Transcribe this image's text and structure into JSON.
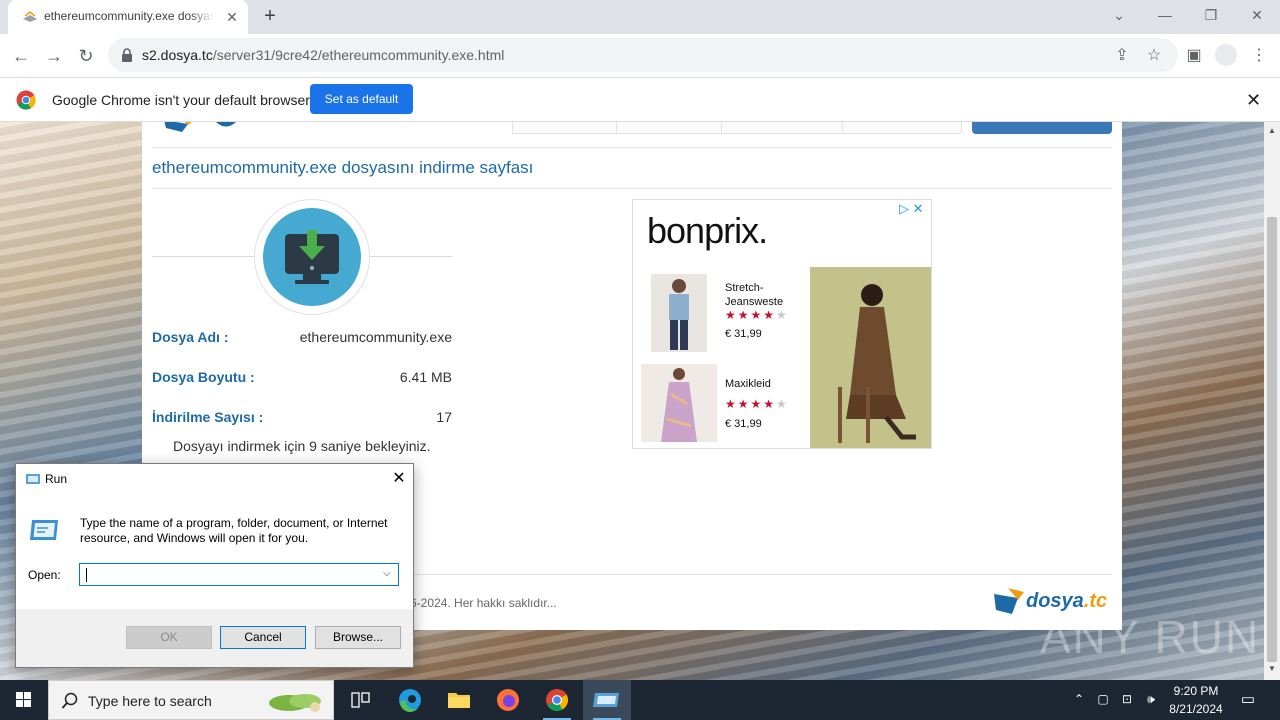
{
  "browser": {
    "tab_title": "ethereumcommunity.exe dosyasını indirme sayfası",
    "url_host": "s2.dosya.tc",
    "url_path": "/server31/9cre42/ethereumcommunity.exe.html",
    "infobar_text": "Google Chrome isn't your default browser",
    "set_default_label": "Set as default"
  },
  "page": {
    "heading": "ethereumcommunity.exe dosyasını indirme sayfası",
    "fields": [
      {
        "label": "Dosya Adı :",
        "value": "ethereumcommunity.exe"
      },
      {
        "label": "Dosya Boyutu :",
        "value": "6.41 MB"
      },
      {
        "label": "İndirilme Sayısı :",
        "value": "17"
      }
    ],
    "wait_text": "Dosyayı indirmek için 9 saniye bekleyiniz.",
    "copyright": "6-2024. Her hakkı saklıdır...",
    "footer_logo": "dosya",
    "footer_logo_tld": ".tc"
  },
  "ad": {
    "brand": "bonprix.",
    "products": [
      {
        "name": "Stretch-Jeansweste",
        "price": "€ 31,99",
        "rating": 4
      },
      {
        "name": "Maxikleid",
        "price": "€ 31,99",
        "rating": 4
      }
    ],
    "star_full": "★★★★",
    "star_empty": "★"
  },
  "run_dialog": {
    "title": "Run",
    "description": "Type the name of a program, folder, document, or Internet resource, and Windows will open it for you.",
    "open_label": "Open:",
    "open_value": "",
    "ok_label": "OK",
    "cancel_label": "Cancel",
    "browse_label": "Browse..."
  },
  "taskbar": {
    "search_placeholder": "Type here to search",
    "time": "9:20 PM",
    "date": "8/21/2024"
  },
  "watermark": "ANY RUN",
  "colors": {
    "link_blue": "#1d6aa7",
    "chrome_blue": "#1a73e8",
    "ad_star": "#c8102e"
  }
}
